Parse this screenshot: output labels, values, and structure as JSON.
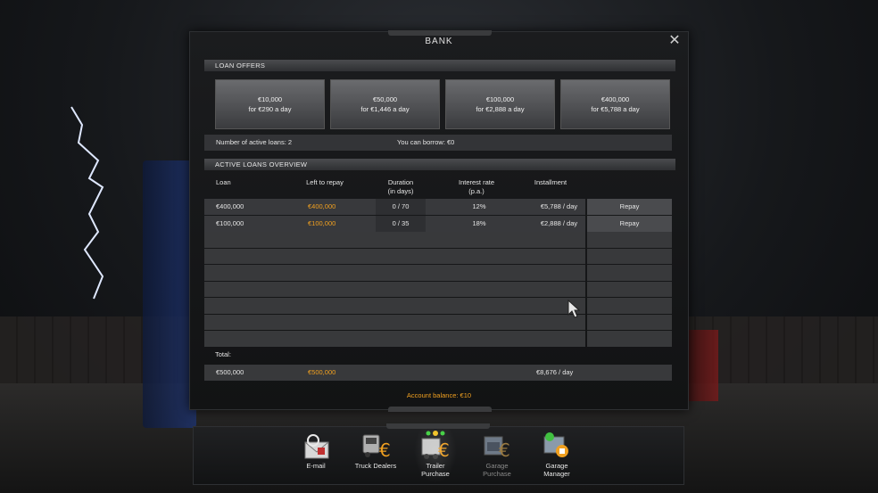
{
  "window": {
    "title": "BANK"
  },
  "loan_offers": {
    "header": "LOAN OFFERS",
    "offers": [
      {
        "amount": "€10,000",
        "rate": "for €290 a day"
      },
      {
        "amount": "€50,000",
        "rate": "for €1,446 a day"
      },
      {
        "amount": "€100,000",
        "rate": "for €2,888 a day"
      },
      {
        "amount": "€400,000",
        "rate": "for €5,788 a day"
      }
    ]
  },
  "summary": {
    "active_loans": "Number of active loans: 2",
    "can_borrow": "You can borrow: €0"
  },
  "active_loans": {
    "header": "ACTIVE LOANS OVERVIEW",
    "columns": {
      "loan": "Loan",
      "left_to_repay": "Left to repay",
      "duration": "Duration",
      "duration_sub": "(in days)",
      "interest": "Interest rate",
      "interest_sub": "(p.a.)",
      "installment": "Installment"
    },
    "rows": [
      {
        "loan": "€400,000",
        "left": "€400,000",
        "duration": "0 / 70",
        "interest": "12%",
        "installment": "€5,788 / day",
        "action": "Repay"
      },
      {
        "loan": "€100,000",
        "left": "€100,000",
        "duration": "0 / 35",
        "interest": "18%",
        "installment": "€2,888 / day",
        "action": "Repay"
      }
    ],
    "total_label": "Total:",
    "total": {
      "loan": "€500,000",
      "left": "€500,000",
      "installment": "€8,676 / day"
    }
  },
  "account_balance": "Account balance: €10",
  "dock": [
    {
      "label": "E-mail",
      "label2": "",
      "icon": "email-icon"
    },
    {
      "label": "Truck Dealers",
      "label2": "",
      "icon": "truck-dealer-icon"
    },
    {
      "label": "Trailer",
      "label2": "Purchase",
      "icon": "trailer-purchase-icon"
    },
    {
      "label": "Garage",
      "label2": "Purchase",
      "icon": "garage-purchase-icon"
    },
    {
      "label": "Garage",
      "label2": "Manager",
      "icon": "garage-manager-icon"
    }
  ],
  "colors": {
    "accent": "#f0a020",
    "panel": "#38393b"
  }
}
